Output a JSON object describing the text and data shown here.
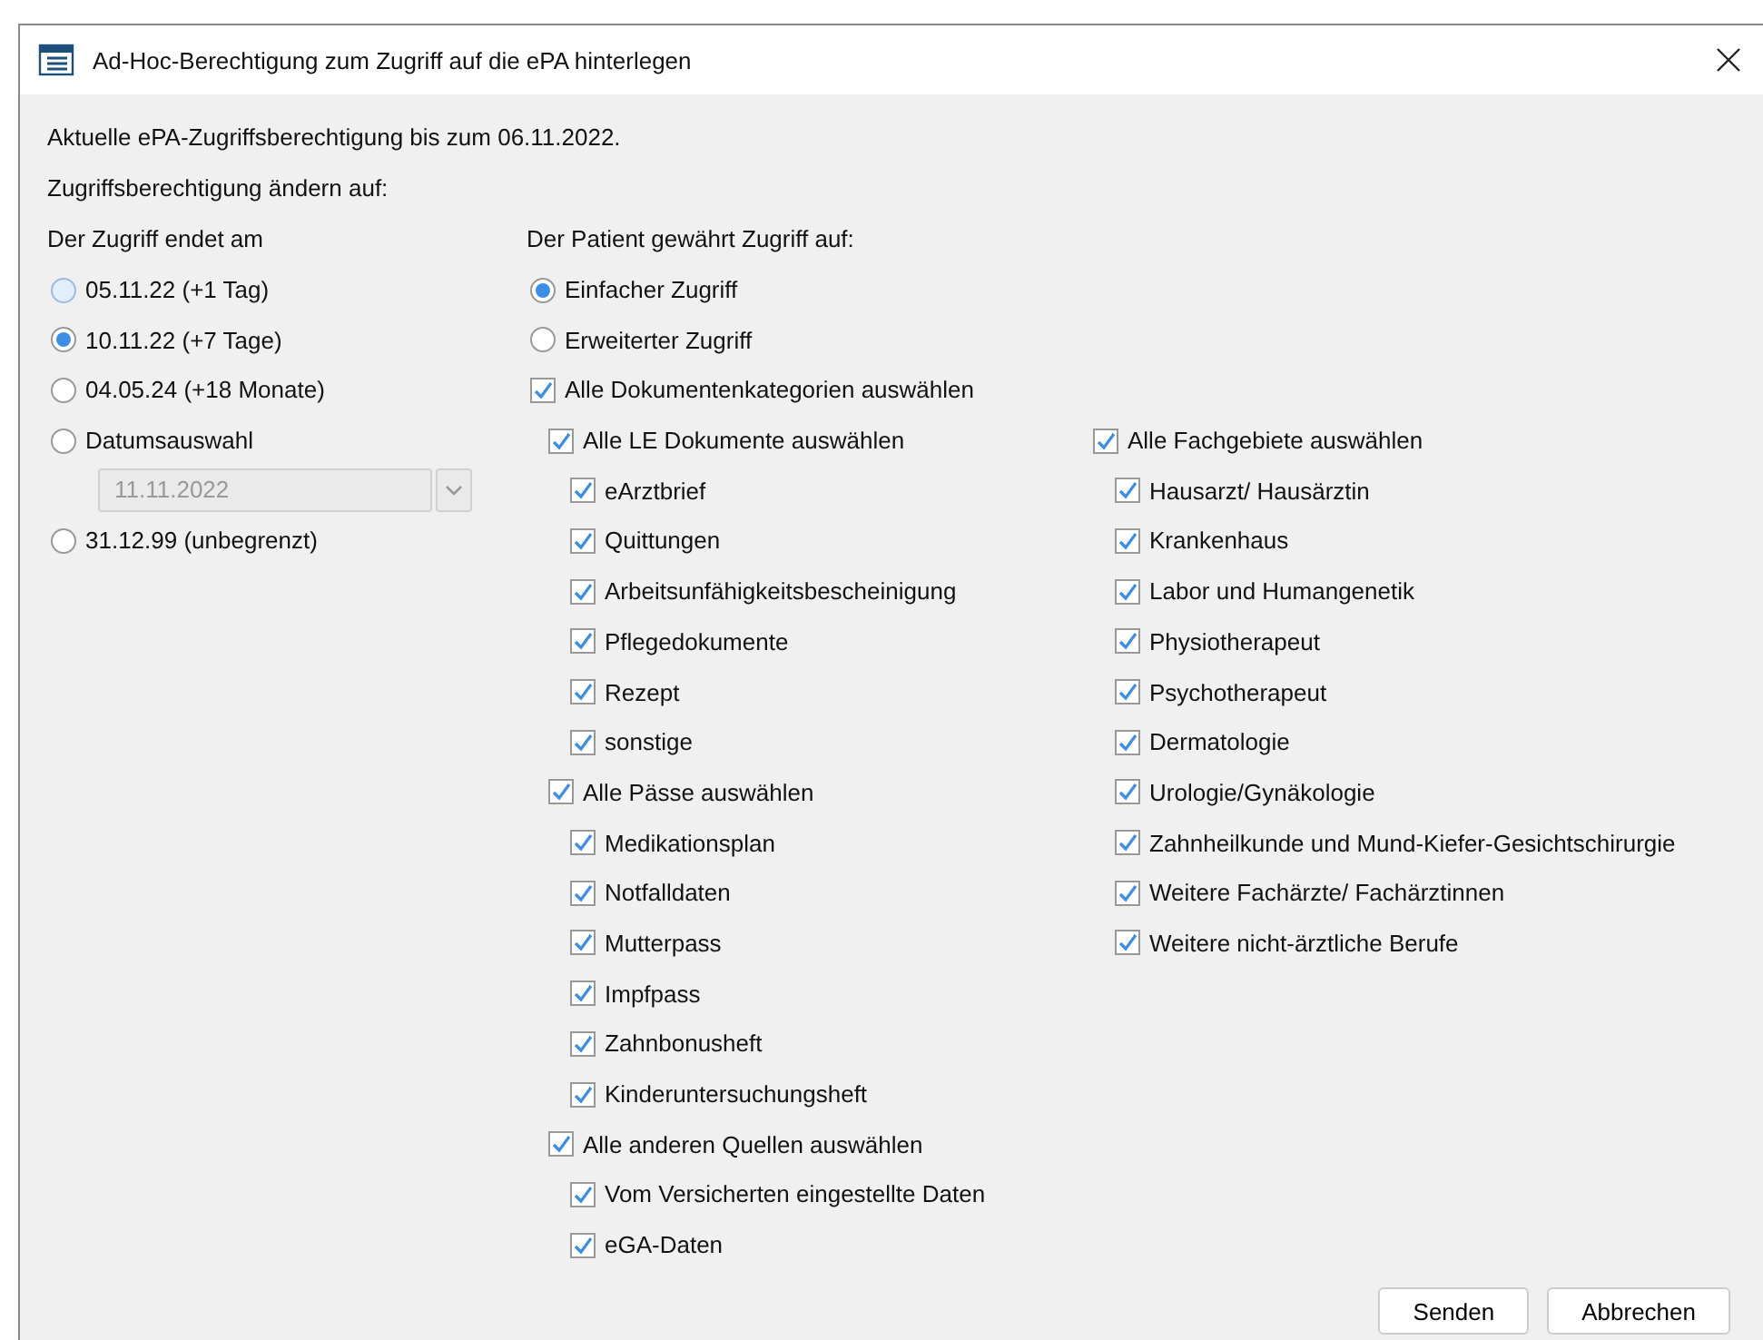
{
  "window": {
    "title": "Ad-Hoc-Berechtigung zum Zugriff auf die ePA hinterlegen"
  },
  "current_text": "Aktuelle ePA-Zugriffsberechtigung bis zum 06.11.2022.",
  "change_label": "Zugriffsberechtigung ändern auf:",
  "end_date": {
    "label": "Der Zugriff endet am",
    "options": [
      {
        "kind": "radio",
        "label": "05.11.22 (+1 Tag)",
        "selected": false,
        "hovered": true
      },
      {
        "kind": "radio",
        "label": "10.11.22 (+7 Tage)",
        "selected": true,
        "hovered": false
      },
      {
        "kind": "radio",
        "label": "04.05.24 (+18 Monate)",
        "selected": false,
        "hovered": false
      },
      {
        "kind": "radio",
        "label": "Datumsauswahl",
        "selected": false,
        "hovered": false
      },
      {
        "kind": "date",
        "value": "11.11.2022",
        "disabled": true
      },
      {
        "kind": "radio",
        "label": "31.12.99 (unbegrenzt)",
        "selected": false,
        "hovered": false
      }
    ]
  },
  "access": {
    "label": "Der Patient gewährt Zugriff auf:",
    "modes": [
      {
        "label": "Einfacher Zugriff",
        "selected": true
      },
      {
        "label": "Erweiterter Zugriff",
        "selected": false
      }
    ],
    "all_categories": {
      "label": "Alle Dokumentenkategorien auswählen",
      "checked": true
    },
    "columns": [
      [
        {
          "label": "Alle LE Dokumente auswählen",
          "checked": true,
          "children": [
            {
              "label": "eArztbrief",
              "checked": true
            },
            {
              "label": "Quittungen",
              "checked": true
            },
            {
              "label": "Arbeitsunfähigkeitsbescheinigung",
              "checked": true
            },
            {
              "label": "Pflegedokumente",
              "checked": true
            },
            {
              "label": "Rezept",
              "checked": true
            },
            {
              "label": "sonstige",
              "checked": true
            }
          ]
        },
        {
          "label": "Alle Pässe auswählen",
          "checked": true,
          "children": [
            {
              "label": "Medikationsplan",
              "checked": true
            },
            {
              "label": "Notfalldaten",
              "checked": true
            },
            {
              "label": "Mutterpass",
              "checked": true
            },
            {
              "label": "Impfpass",
              "checked": true
            },
            {
              "label": "Zahnbonusheft",
              "checked": true
            },
            {
              "label": "Kinderuntersuchungsheft",
              "checked": true
            }
          ]
        },
        {
          "label": "Alle anderen Quellen auswählen",
          "checked": true,
          "children": [
            {
              "label": "Vom Versicherten eingestellte Daten",
              "checked": true
            },
            {
              "label": "eGA-Daten",
              "checked": true
            }
          ]
        }
      ],
      [
        {
          "label": "Alle Fachgebiete auswählen",
          "checked": true,
          "children": [
            {
              "label": "Hausarzt/ Hausärztin",
              "checked": true
            },
            {
              "label": "Krankenhaus",
              "checked": true
            },
            {
              "label": "Labor und Humangenetik",
              "checked": true
            },
            {
              "label": "Physiotherapeut",
              "checked": true
            },
            {
              "label": "Psychotherapeut",
              "checked": true
            },
            {
              "label": "Dermatologie",
              "checked": true
            },
            {
              "label": "Urologie/Gynäkologie",
              "checked": true
            },
            {
              "label": "Zahnheilkunde und Mund-Kiefer-Gesichtschirurgie",
              "checked": true
            },
            {
              "label": "Weitere Fachärzte/ Fachärztinnen",
              "checked": true
            },
            {
              "label": "Weitere nicht-ärztliche Berufe",
              "checked": true
            }
          ]
        }
      ]
    ]
  },
  "buttons": [
    "Senden",
    "Abbrechen"
  ]
}
